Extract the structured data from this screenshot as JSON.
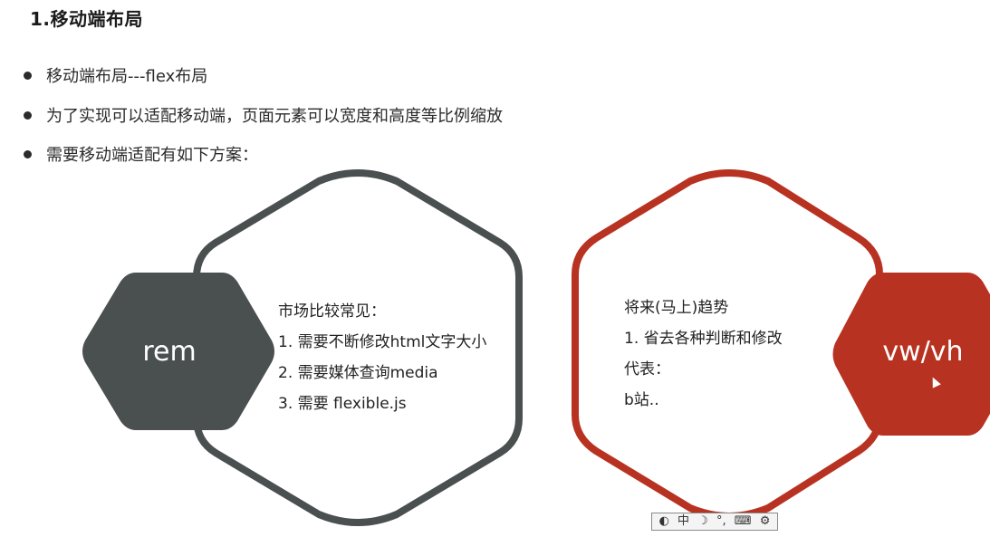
{
  "title": "1.移动端布局",
  "bullets": [
    "移动端布局---flex布局",
    "为了实现可以适配移动端，页面元素可以宽度和高度等比例缩放",
    "需要移动端适配有如下方案："
  ],
  "left": {
    "hex_label": "rem",
    "lines": [
      "市场比较常见：",
      "1. 需要不断修改html文字大小",
      "2. 需要媒体查询media",
      "3. 需要 flexible.js"
    ]
  },
  "right": {
    "hex_label": "vw/vh",
    "lines": [
      "将来(马上)趋势",
      "1. 省去各种判断和修改",
      "代表：",
      "b站.."
    ]
  },
  "ime_toolbar": {
    "items": [
      "◐",
      "中",
      "☽",
      "°,",
      "⌨",
      "⚙"
    ],
    "icon_names": [
      "input-mode-icon",
      "chinese-mode-label",
      "half-width-icon",
      "punctuation-icon",
      "keyboard-icon",
      "settings-icon"
    ]
  },
  "colors": {
    "gray": "#4a4f4f",
    "red": "#b83222"
  }
}
